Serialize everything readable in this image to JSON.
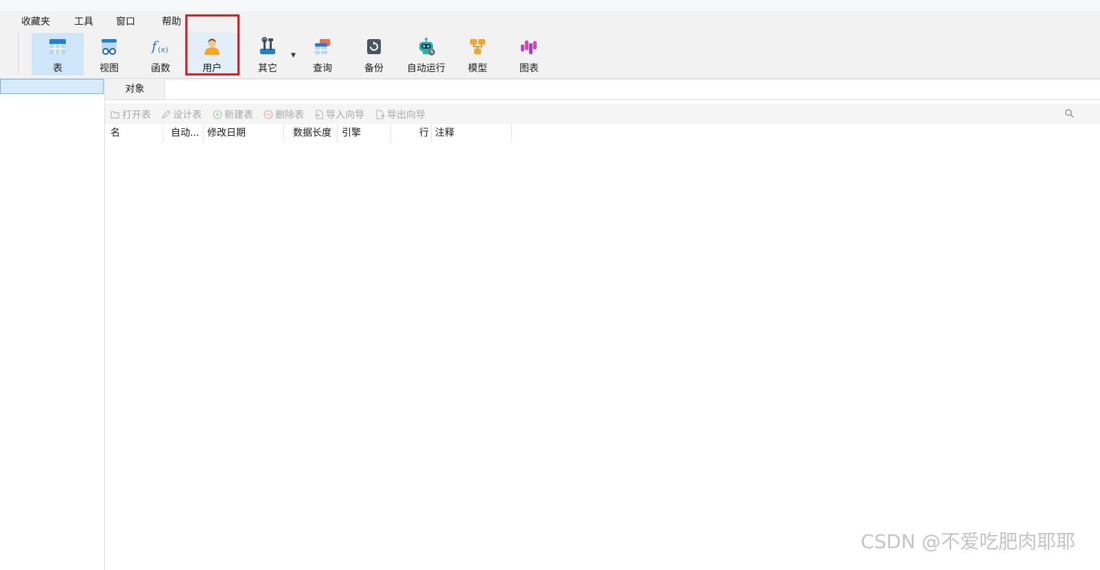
{
  "menu": {
    "items": [
      {
        "label": "收藏夹"
      },
      {
        "label": "工具"
      },
      {
        "label": "窗口"
      },
      {
        "label": "帮助"
      }
    ]
  },
  "toolbar": {
    "buttons": [
      {
        "label": "表",
        "icon": "table-icon"
      },
      {
        "label": "视图",
        "icon": "view-icon"
      },
      {
        "label": "函数",
        "icon": "function-icon"
      },
      {
        "label": "用户",
        "icon": "user-icon"
      },
      {
        "label": "其它",
        "icon": "tools-icon"
      },
      {
        "label": "查询",
        "icon": "query-icon"
      },
      {
        "label": "备份",
        "icon": "backup-icon"
      },
      {
        "label": "自动运行",
        "icon": "robot-icon"
      },
      {
        "label": "模型",
        "icon": "model-icon"
      },
      {
        "label": "图表",
        "icon": "chart-icon"
      }
    ],
    "active": "表",
    "highlighted": "用户",
    "highlight_color": "#e0191f"
  },
  "tabs": {
    "items": [
      {
        "label": "对象"
      }
    ]
  },
  "actions": {
    "items": [
      {
        "label": "打开表",
        "icon": "folder-open-icon"
      },
      {
        "label": "设计表",
        "icon": "pencil-icon"
      },
      {
        "label": "新建表",
        "icon": "plus-circle-icon"
      },
      {
        "label": "删除表",
        "icon": "minus-circle-icon"
      },
      {
        "label": "导入向导",
        "icon": "import-icon"
      },
      {
        "label": "导出向导",
        "icon": "export-icon"
      }
    ],
    "search_icon": "search-icon"
  },
  "grid": {
    "columns": [
      {
        "label": "名"
      },
      {
        "label": "自动..."
      },
      {
        "label": "修改日期"
      },
      {
        "label": "数据长度"
      },
      {
        "label": "引擎"
      },
      {
        "label": "行"
      },
      {
        "label": "注释"
      }
    ],
    "rows": []
  },
  "watermark": {
    "text": "CSDN @不爱吃肥肉耶耶"
  },
  "colors": {
    "accent_selected": "#cfe5f8",
    "disabled_text": "#a8a8a8"
  }
}
